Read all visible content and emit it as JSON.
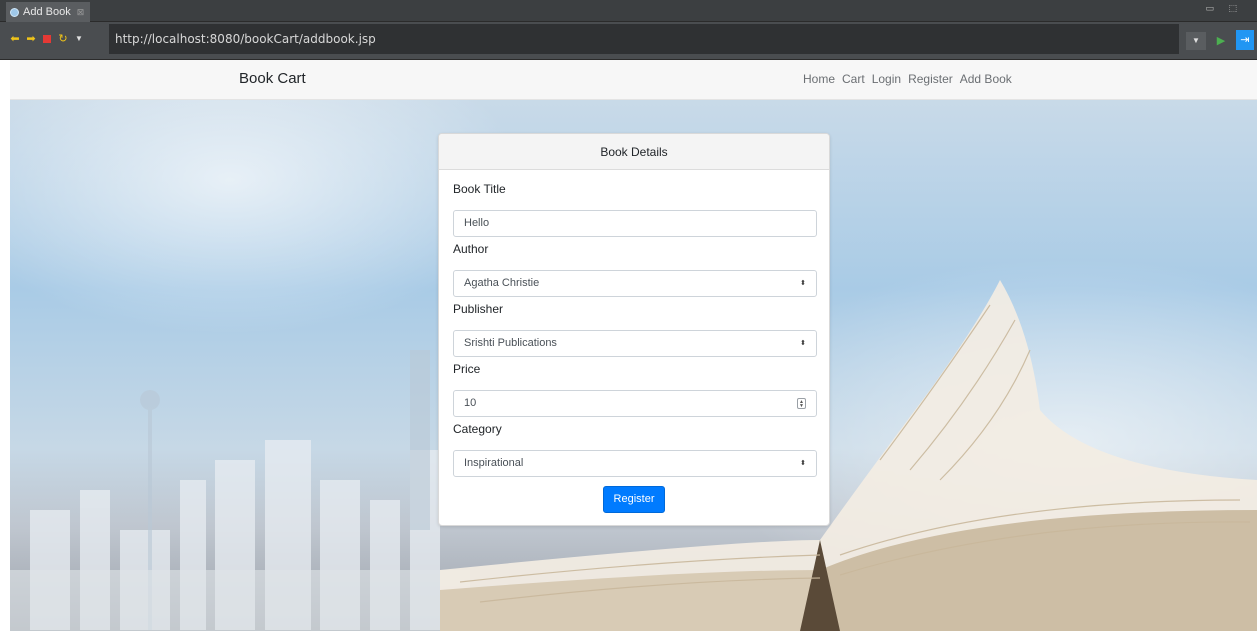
{
  "window": {
    "tab_title": "Add Book",
    "url": "http://localhost:8080/bookCart/addbook.jsp"
  },
  "site": {
    "brand": "Book Cart",
    "nav": [
      "Home",
      "Cart",
      "Login",
      "Register",
      "Add Book"
    ]
  },
  "form": {
    "header": "Book Details",
    "fields": {
      "title": {
        "label": "Book Title",
        "value": "Hello"
      },
      "author": {
        "label": "Author",
        "value": "Agatha Christie"
      },
      "publisher": {
        "label": "Publisher",
        "value": "Srishti Publications"
      },
      "price": {
        "label": "Price",
        "value": "10"
      },
      "category": {
        "label": "Category",
        "value": "Inspirational"
      }
    },
    "submit_label": "Register"
  },
  "icons": {
    "back": "arrow-left-icon",
    "forward": "arrow-right-icon",
    "stop": "stop-icon",
    "refresh": "refresh-icon",
    "menu": "chevron-down-icon",
    "go": "play-icon",
    "external": "external-browser-icon"
  },
  "colors": {
    "primary": "#007bff",
    "navbar": "#f7f7f7",
    "chrome_dark": "#3c3f41",
    "accent_yellow": "#f0c419",
    "stop_red": "#e53935",
    "go_green": "#4caf50",
    "ext_blue": "#2196f3"
  }
}
